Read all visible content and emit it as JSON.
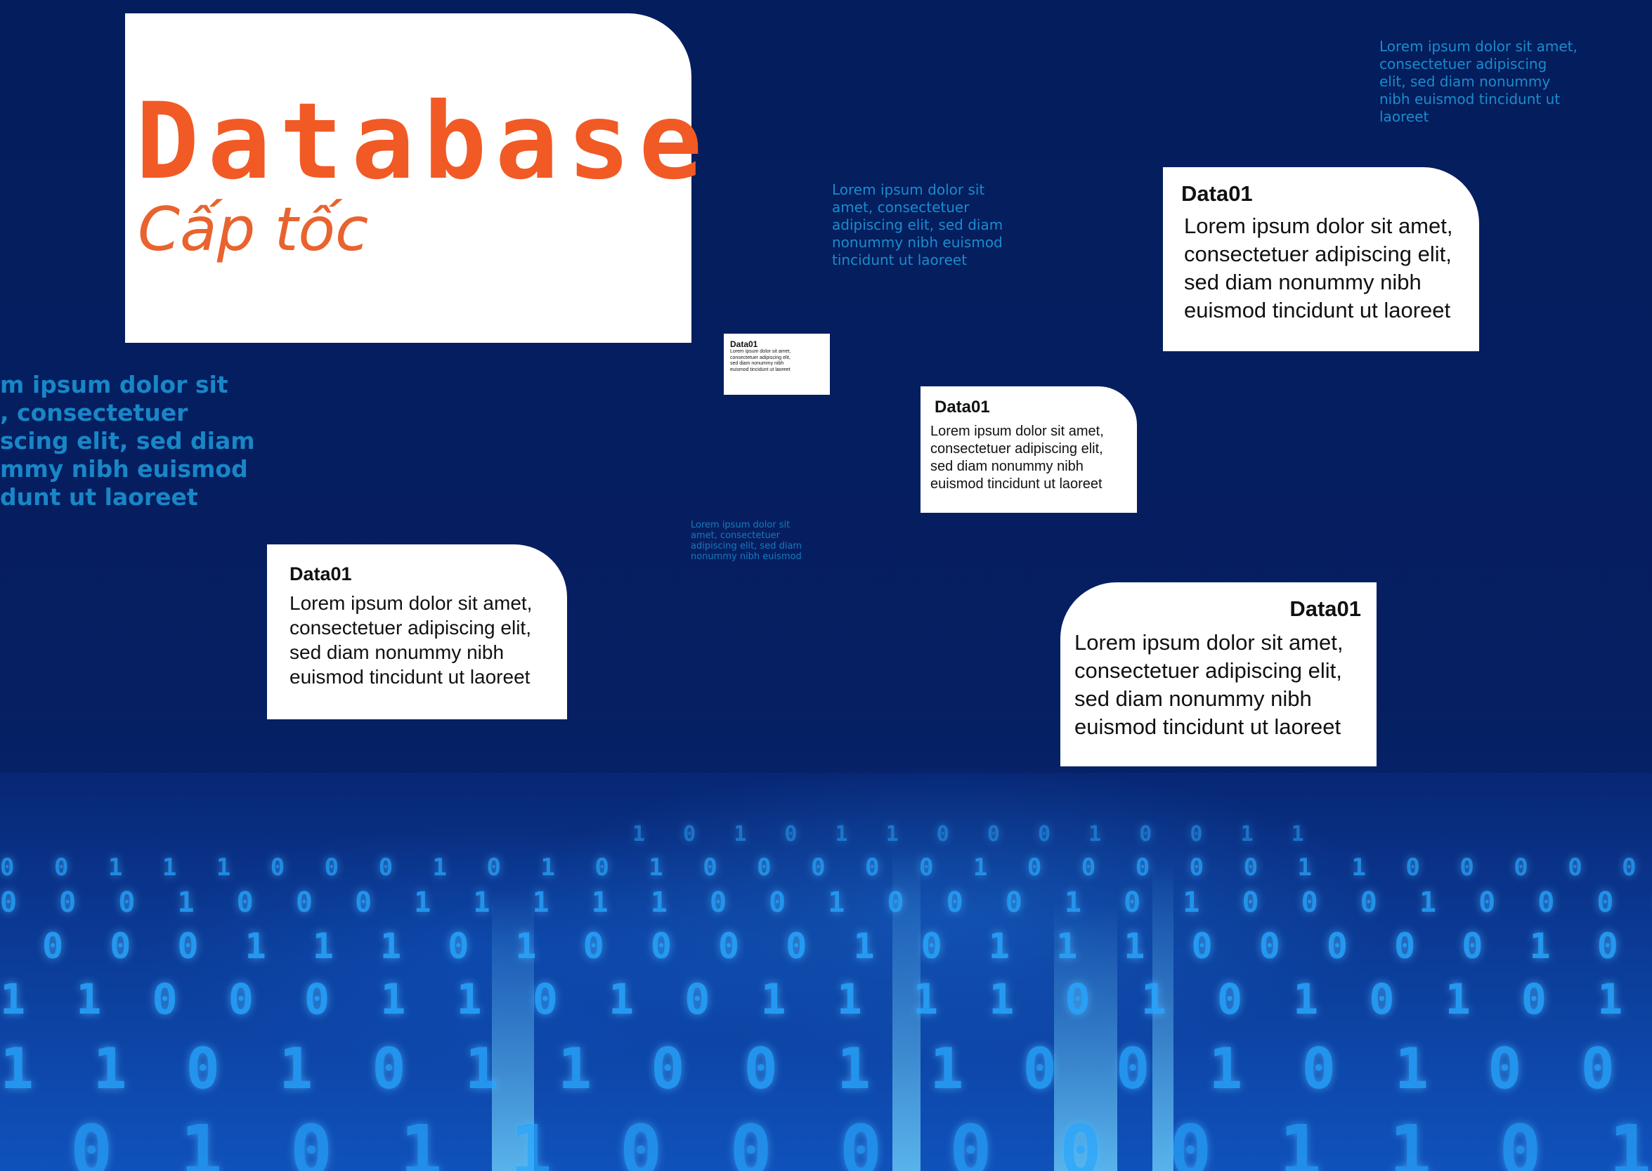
{
  "header": {
    "title": "Database",
    "subtitle": "Cấp tốc"
  },
  "cards": [
    {
      "heading": "Data01",
      "body": "Lorem ipsum dolor sit amet,\nconsectetuer adipiscing elit,\nsed diam nonummy nibh\neuismod tincidunt ut laoreet"
    },
    {
      "heading": "Data01",
      "body": "Lorem ipsum dolor sit amet,\nconsectetuer adipiscing elit,\nsed diam nonummy nibh\neuismod tincidunt ut laoreet"
    },
    {
      "heading": "Data01",
      "body": "Lorem ipsum dolor sit amet,\nconsectetuer adipiscing elit,\nsed diam nonummy nibh\neuismod tincidunt ut laoreet"
    },
    {
      "heading": "Data01",
      "body": "Lorem ipsum dolor sit amet,\nconsectetuer adipiscing elit,\nsed diam nonummy nibh\neuismod tincidunt ut laoreet"
    },
    {
      "heading": "Data01",
      "body": "Lorem ipsum dolor sit amet,\nconsectetuer adipiscing elit,\nsed diam nonummy nibh\neuismod tincidunt ut laoreet"
    }
  ],
  "ghost_texts": [
    "Lorem ipsum dolor sit amet,\nconsectetuer adipiscing\nelit, sed diam nonummy\nnibh euismod tincidunt ut\nlaoreet",
    "Lorem ipsum dolor sit\namet, consectetuer\nadipiscing elit, sed diam\nnonummy nibh euismod\ntincidunt ut laoreet",
    "m ipsum dolor sit\n, consectetuer\nscing elit, sed diam\nmmy nibh euismod\ndunt ut laoreet",
    "Lorem ipsum dolor sit\namet, consectetuer\nadipiscing elit, sed diam\nnonummy nibh euismod"
  ],
  "binary_rows": [
    "1 0   1 0   1 1 0 0 0   1 0 0 1 1",
    "0 0 1 1 1 0 0 0 1 0 1 0 1 0 0 0 0 0 1 0 0 0 0 0 1 1 0 0 0 0 0 0 0 0 0 1",
    "0 0 0 1 0 0 0 1 1 1 1 1 0 0 1 0 0 0 1 0 1 0 0 0 1 0 0 0 0 1 1 0",
    "0   0 0 1 1 1 0 1 0 0 0 0 1 0 1 1 1 0 0 0 0   0 1 0 0 0",
    "1 1 0 0 0 1 1 0 1 0 1 1 1 1 0 1 0 1 0 1 0 1 0 0 0 1",
    "1 1 0 1 0 1 1 0 0 1 1 0 0 1 0 1 0 0 1 0",
    "0 1 0   1 1 0 0 0 0 0 0 1 1 0 1 1"
  ],
  "colors": {
    "background": "#061f5f",
    "title_orange": "#f15a24",
    "binary_blue": "#29a8ff"
  }
}
